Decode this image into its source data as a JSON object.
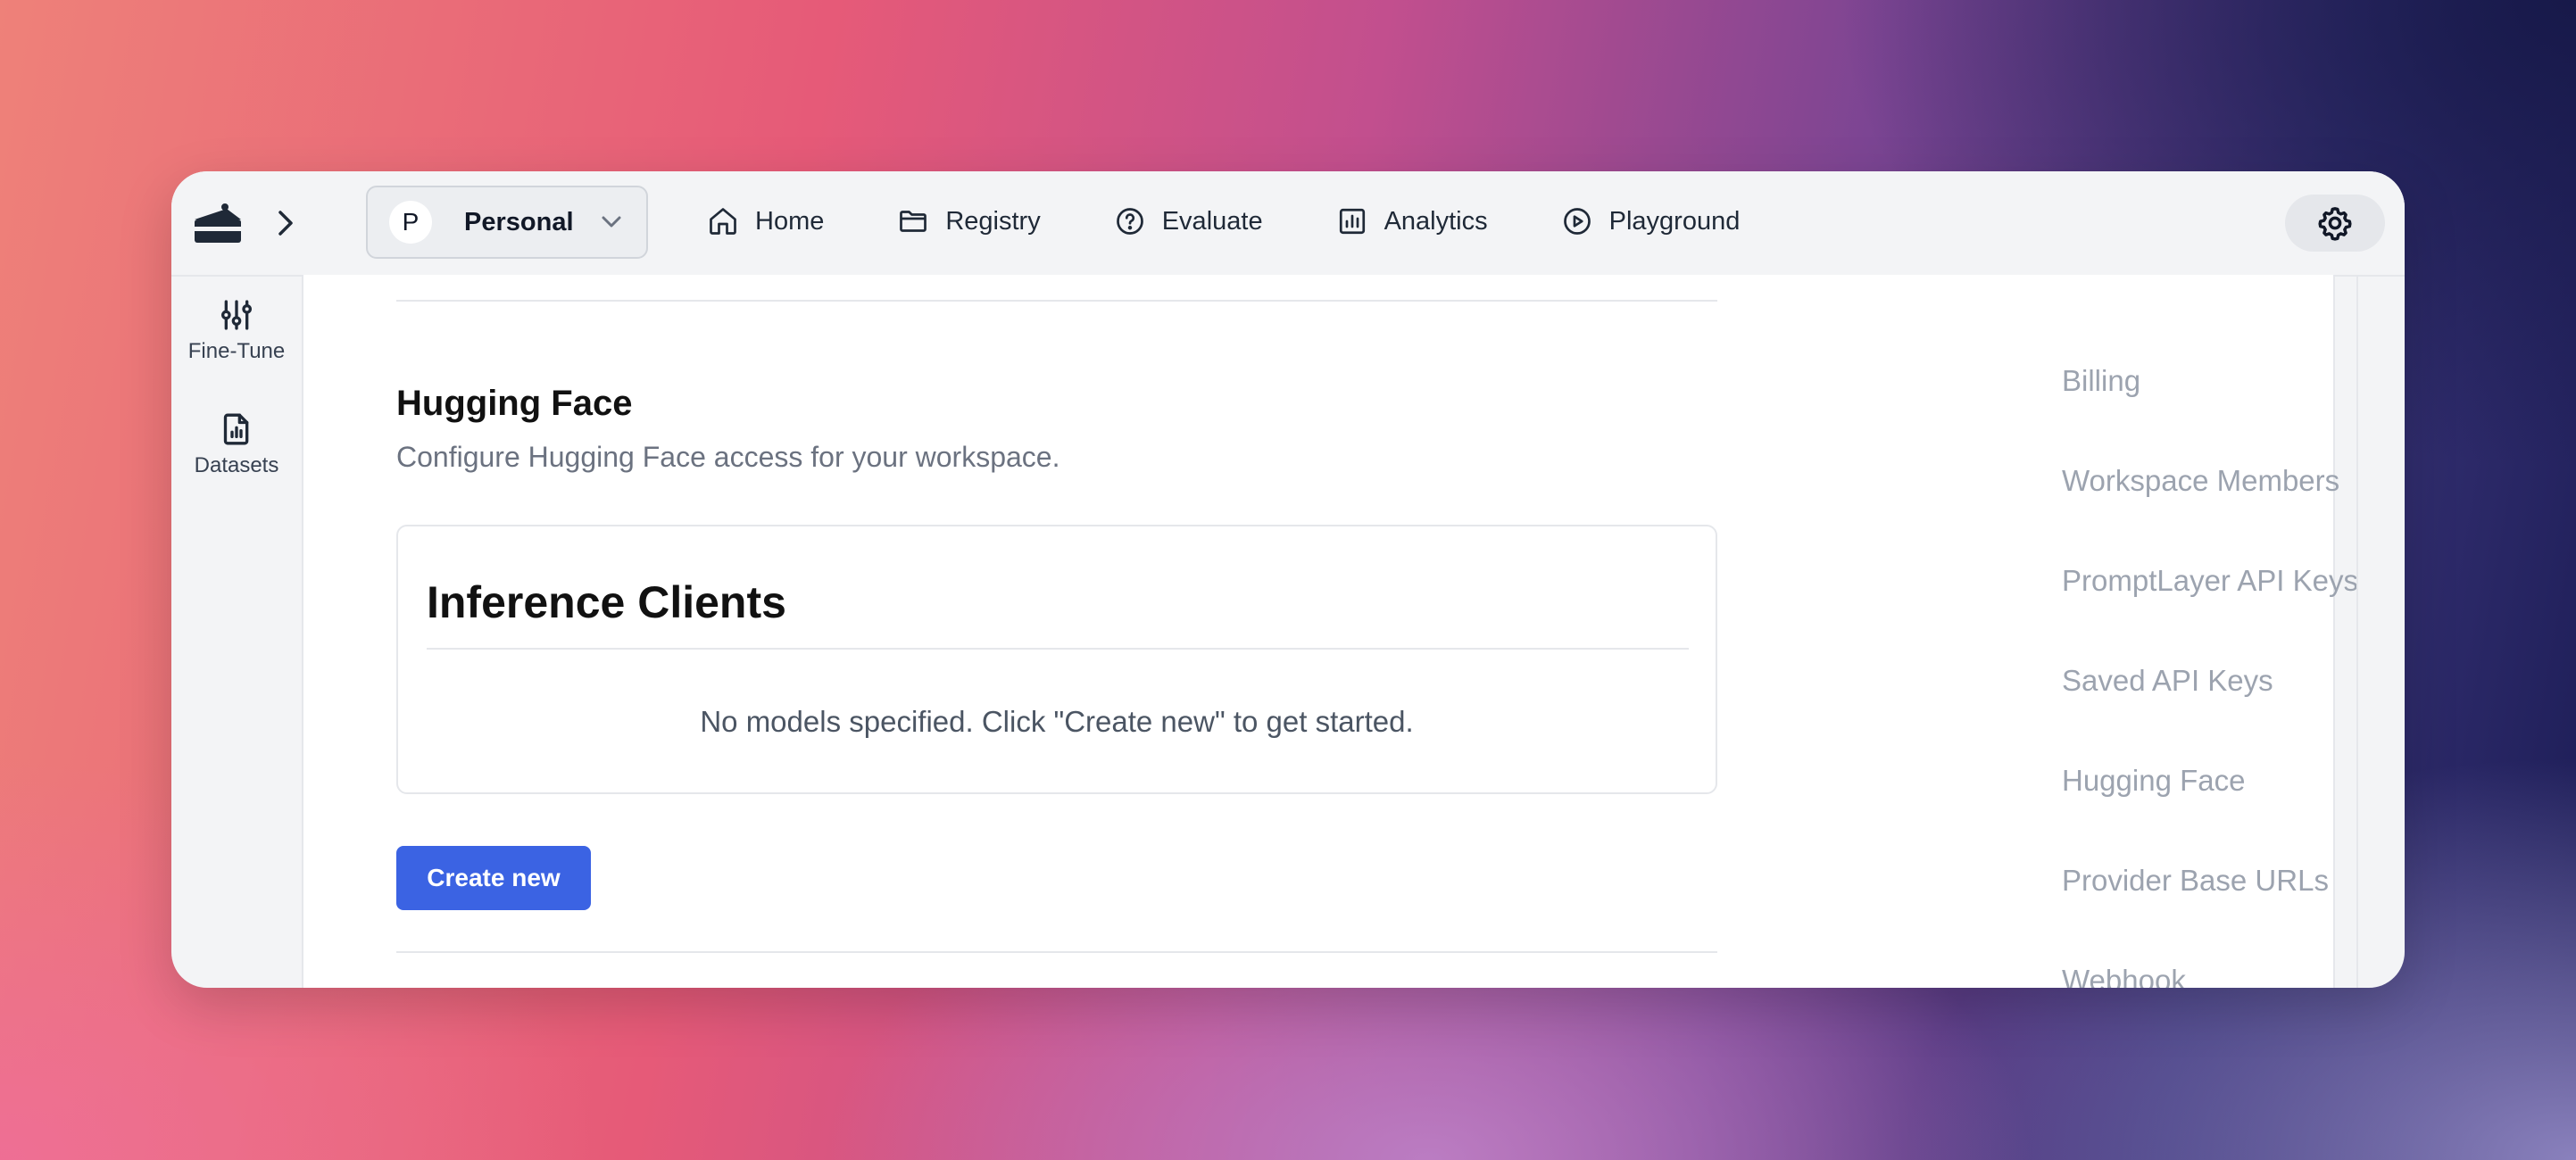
{
  "topbar": {
    "workspace": {
      "initial": "P",
      "name": "Personal"
    },
    "nav": [
      {
        "label": "Home",
        "icon": "home-icon"
      },
      {
        "label": "Registry",
        "icon": "folder-icon"
      },
      {
        "label": "Evaluate",
        "icon": "help-circle-icon"
      },
      {
        "label": "Analytics",
        "icon": "bar-chart-icon"
      },
      {
        "label": "Playground",
        "icon": "play-circle-icon"
      }
    ]
  },
  "sidebar": {
    "items": [
      {
        "label": "Fine-Tune",
        "icon": "sliders-icon"
      },
      {
        "label": "Datasets",
        "icon": "file-chart-icon"
      }
    ]
  },
  "main": {
    "section_title": "Hugging Face",
    "section_description": "Configure Hugging Face access for your workspace.",
    "card": {
      "title": "Inference Clients",
      "empty_message": "No models specified. Click \"Create new\" to get started."
    },
    "create_button": "Create new"
  },
  "toc": {
    "items": [
      "Billing",
      "Workspace Members",
      "PromptLayer API Keys",
      "Saved API Keys",
      "Hugging Face",
      "Provider Base URLs",
      "Webhook"
    ]
  },
  "colors": {
    "primary": "#3b63e3",
    "muted_text": "#9ca3af",
    "border": "#e5e7eb"
  }
}
